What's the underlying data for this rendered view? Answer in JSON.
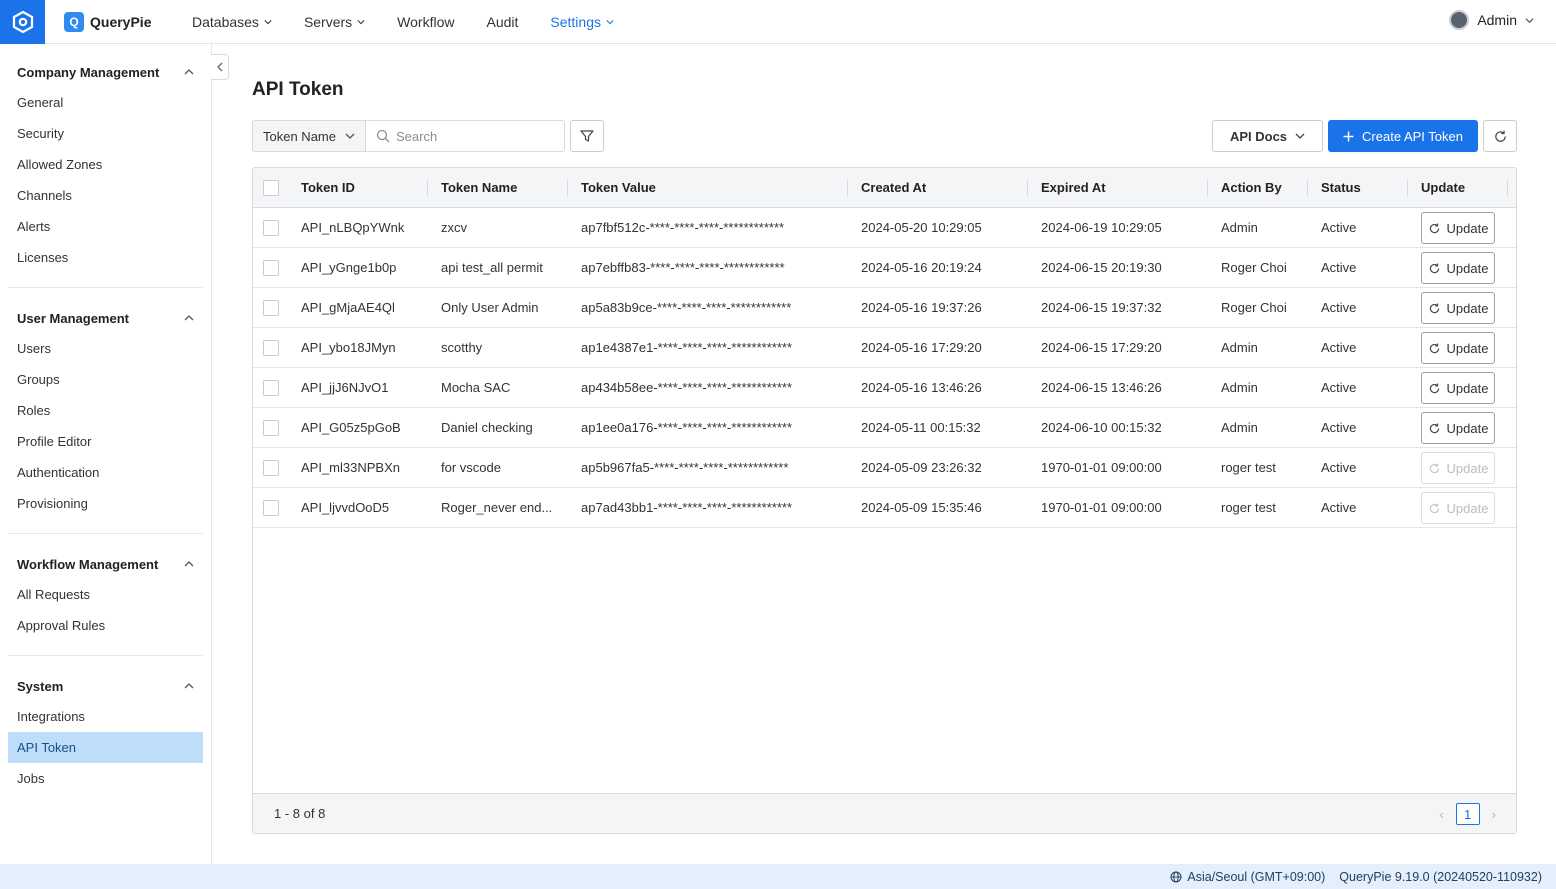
{
  "topbar": {
    "brand": "QueryPie",
    "brand_letter": "Q",
    "nav": [
      {
        "label": "Databases",
        "dropdown": true,
        "active": false
      },
      {
        "label": "Servers",
        "dropdown": true,
        "active": false
      },
      {
        "label": "Workflow",
        "dropdown": false,
        "active": false
      },
      {
        "label": "Audit",
        "dropdown": false,
        "active": false
      },
      {
        "label": "Settings",
        "dropdown": true,
        "active": true
      }
    ],
    "user": "Admin"
  },
  "sidebar": {
    "sections": [
      {
        "title": "Company Management",
        "items": [
          "General",
          "Security",
          "Allowed Zones",
          "Channels",
          "Alerts",
          "Licenses"
        ]
      },
      {
        "title": "User Management",
        "items": [
          "Users",
          "Groups",
          "Roles",
          "Profile Editor",
          "Authentication",
          "Provisioning"
        ]
      },
      {
        "title": "Workflow Management",
        "items": [
          "All Requests",
          "Approval Rules"
        ]
      },
      {
        "title": "System",
        "items": [
          "Integrations",
          "API Token",
          "Jobs"
        ]
      }
    ],
    "active_item": "API Token"
  },
  "page": {
    "title": "API Token",
    "filter_field": "Token Name",
    "search_placeholder": "Search",
    "api_docs_label": "API Docs",
    "create_label": "Create API Token"
  },
  "table": {
    "columns": [
      "Token ID",
      "Token Name",
      "Token Value",
      "Created At",
      "Expired At",
      "Action By",
      "Status",
      "Update"
    ],
    "rows": [
      {
        "id": "API_nLBQpYWnk",
        "name": "zxcv",
        "value": "ap7fbf512c-****-****-****-************",
        "created": "2024-05-20 10:29:05",
        "expired": "2024-06-19 10:29:05",
        "by": "Admin",
        "status": "Active",
        "update": "Update",
        "enabled": true
      },
      {
        "id": "API_yGnge1b0p",
        "name": "api test_all permit",
        "value": "ap7ebffb83-****-****-****-************",
        "created": "2024-05-16 20:19:24",
        "expired": "2024-06-15 20:19:30",
        "by": "Roger Choi",
        "status": "Active",
        "update": "Update",
        "enabled": true
      },
      {
        "id": "API_gMjaAE4Ql",
        "name": "Only User Admin",
        "value": "ap5a83b9ce-****-****-****-************",
        "created": "2024-05-16 19:37:26",
        "expired": "2024-06-15 19:37:32",
        "by": "Roger Choi",
        "status": "Active",
        "update": "Update",
        "enabled": true
      },
      {
        "id": "API_ybo18JMyn",
        "name": "scotthy",
        "value": "ap1e4387e1-****-****-****-************",
        "created": "2024-05-16 17:29:20",
        "expired": "2024-06-15 17:29:20",
        "by": "Admin",
        "status": "Active",
        "update": "Update",
        "enabled": true
      },
      {
        "id": "API_jjJ6NJvO1",
        "name": "Mocha SAC",
        "value": "ap434b58ee-****-****-****-************",
        "created": "2024-05-16 13:46:26",
        "expired": "2024-06-15 13:46:26",
        "by": "Admin",
        "status": "Active",
        "update": "Update",
        "enabled": true
      },
      {
        "id": "API_G05z5pGoB",
        "name": "Daniel checking",
        "value": "ap1ee0a176-****-****-****-************",
        "created": "2024-05-11 00:15:32",
        "expired": "2024-06-10 00:15:32",
        "by": "Admin",
        "status": "Active",
        "update": "Update",
        "enabled": true
      },
      {
        "id": "API_ml33NPBXn",
        "name": "for vscode",
        "value": "ap5b967fa5-****-****-****-************",
        "created": "2024-05-09 23:26:32",
        "expired": "1970-01-01 09:00:00",
        "by": "roger test",
        "status": "Active",
        "update": "Update",
        "enabled": false
      },
      {
        "id": "API_ljvvdOoD5",
        "name": "Roger_never end...",
        "value": "ap7ad43bb1-****-****-****-************",
        "created": "2024-05-09 15:35:46",
        "expired": "1970-01-01 09:00:00",
        "by": "roger test",
        "status": "Active",
        "update": "Update",
        "enabled": false
      }
    ],
    "range_text": "1 - 8 of 8",
    "current_page": "1"
  },
  "statusbar": {
    "timezone": "Asia/Seoul (GMT+09:00)",
    "version": "QueryPie 9.19.0 (20240520-110932)"
  },
  "colors": {
    "accent": "#1a73e8",
    "active_nav_bg": "#bdddfb"
  }
}
